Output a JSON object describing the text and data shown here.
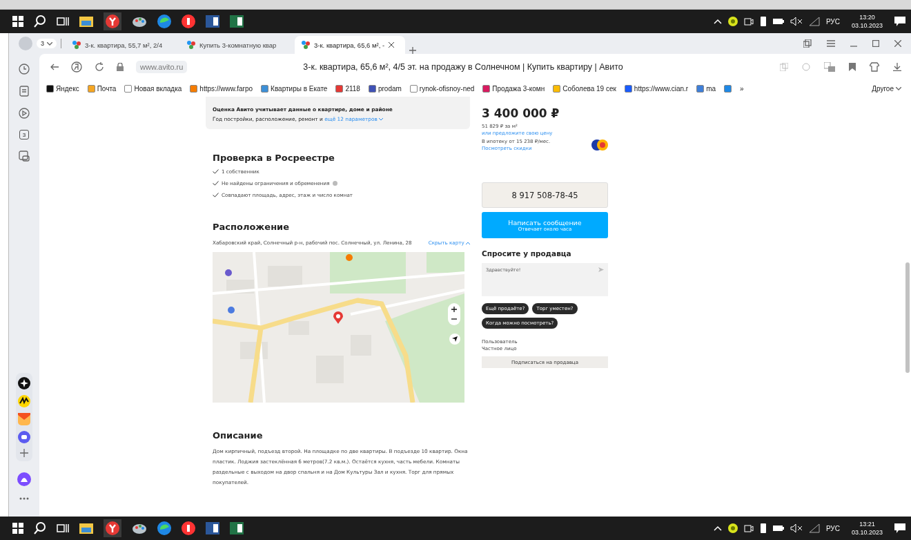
{
  "top_taskbar": {
    "language": "РУС",
    "time": "13:20",
    "date": "03.10.2023"
  },
  "browser": {
    "tab_counter": "3",
    "tabs": [
      {
        "title": "3-к. квартира, 55,7 м², 2/4",
        "selected": false
      },
      {
        "title": "Купить 3-комнатную квар",
        "selected": false
      },
      {
        "title": "3-к. квартира, 65,6 м², -",
        "selected": true
      }
    ],
    "url": "www.avito.ru",
    "page_title": "3-к. квартира, 65,6 м², 4/5 эт. на продажу в Солнечном | Купить квартиру | Авито",
    "bookmarks": [
      {
        "label": "Яндекс",
        "color": "#111111"
      },
      {
        "label": "Почта",
        "color": "#f5a623"
      },
      {
        "label": "Новая вкладка",
        "color": "#ffffff"
      },
      {
        "label": "https://www.farpo",
        "color": "#f57c00"
      },
      {
        "label": "Квартиры в Екате",
        "color": "#3d8fd6"
      },
      {
        "label": "2118",
        "color": "#e53935"
      },
      {
        "label": "prodam",
        "color": "#3f51b5"
      },
      {
        "label": "rynok-ofisnoy-ned",
        "color": "#ffffff"
      },
      {
        "label": "Продажа 3-комн",
        "color": "#d81b60"
      },
      {
        "label": "Соболева 19 сек",
        "color": "#fbbc05"
      },
      {
        "label": "https://www.cian.r",
        "color": "#1a5cff"
      },
      {
        "label": "ma",
        "color": "#3f7fd8"
      },
      {
        "color": "#1e88e5"
      }
    ],
    "bookmarks_more": "»",
    "other_bookmarks": "Другое"
  },
  "side_panel": {
    "counter": "3"
  },
  "listing": {
    "estimate_card": {
      "title": "Оценка Авито учитывает данные о квартире, доме и районе",
      "text": "Год постройки, расположение, ремонт и",
      "link": "ещё 12 параметров"
    },
    "registry": {
      "heading": "Проверка в Росреестре",
      "checks": [
        {
          "text": "1 собственник",
          "info": false
        },
        {
          "text": "Не найдены ограничения и обременения",
          "info": true
        },
        {
          "text": "Совпадают площадь, адрес, этаж и число комнат",
          "info": false
        }
      ]
    },
    "location": {
      "heading": "Расположение",
      "address": "Хабаровский край, Солнечный р-н, рабочий пос. Солнечный, ул. Ленина, 28",
      "hide_map_link": "Скрыть карту"
    },
    "description": {
      "heading": "Описание",
      "text": "Дом кирпичный, подъезд второй. На площадке по две квартиры. В подъезде 10 квартир. Окна пластик. Лоджия застеклённая 6 метров(7.2 кв.м.). Остаётся кухня, часть мебели. Комнаты раздельные с выходом на двор спальня и на Дом Культуры Зал и кухня. Торг для прямых покупателей."
    }
  },
  "seller_panel": {
    "price": "3 400 000 ₽",
    "price_per_meter": "51 829 ₽ за м²",
    "offer_link": "или предложите свою цену",
    "mortgage": "В ипотеку от 15 238 ₽/мес.",
    "mortgage_link": "Посмотреть скидки",
    "phone_button": "8 917 508-78-45",
    "message_button": {
      "label": "Написать сообщение",
      "subtitle": "Отвечает около часа"
    },
    "ask_heading": "Спросите у продавца",
    "message_value": "Здравствуйте!",
    "quick_questions": [
      "Ещё продаёте?",
      "Торг уместен?",
      "Когда можно посмотреть?"
    ],
    "seller_name": "Пользователь",
    "seller_type": "Частное лицо",
    "subscribe_button": "Подписаться на продавца"
  },
  "bottom_taskbar": {
    "language": "РУС",
    "time": "13:21",
    "date": "03.10.2023"
  }
}
